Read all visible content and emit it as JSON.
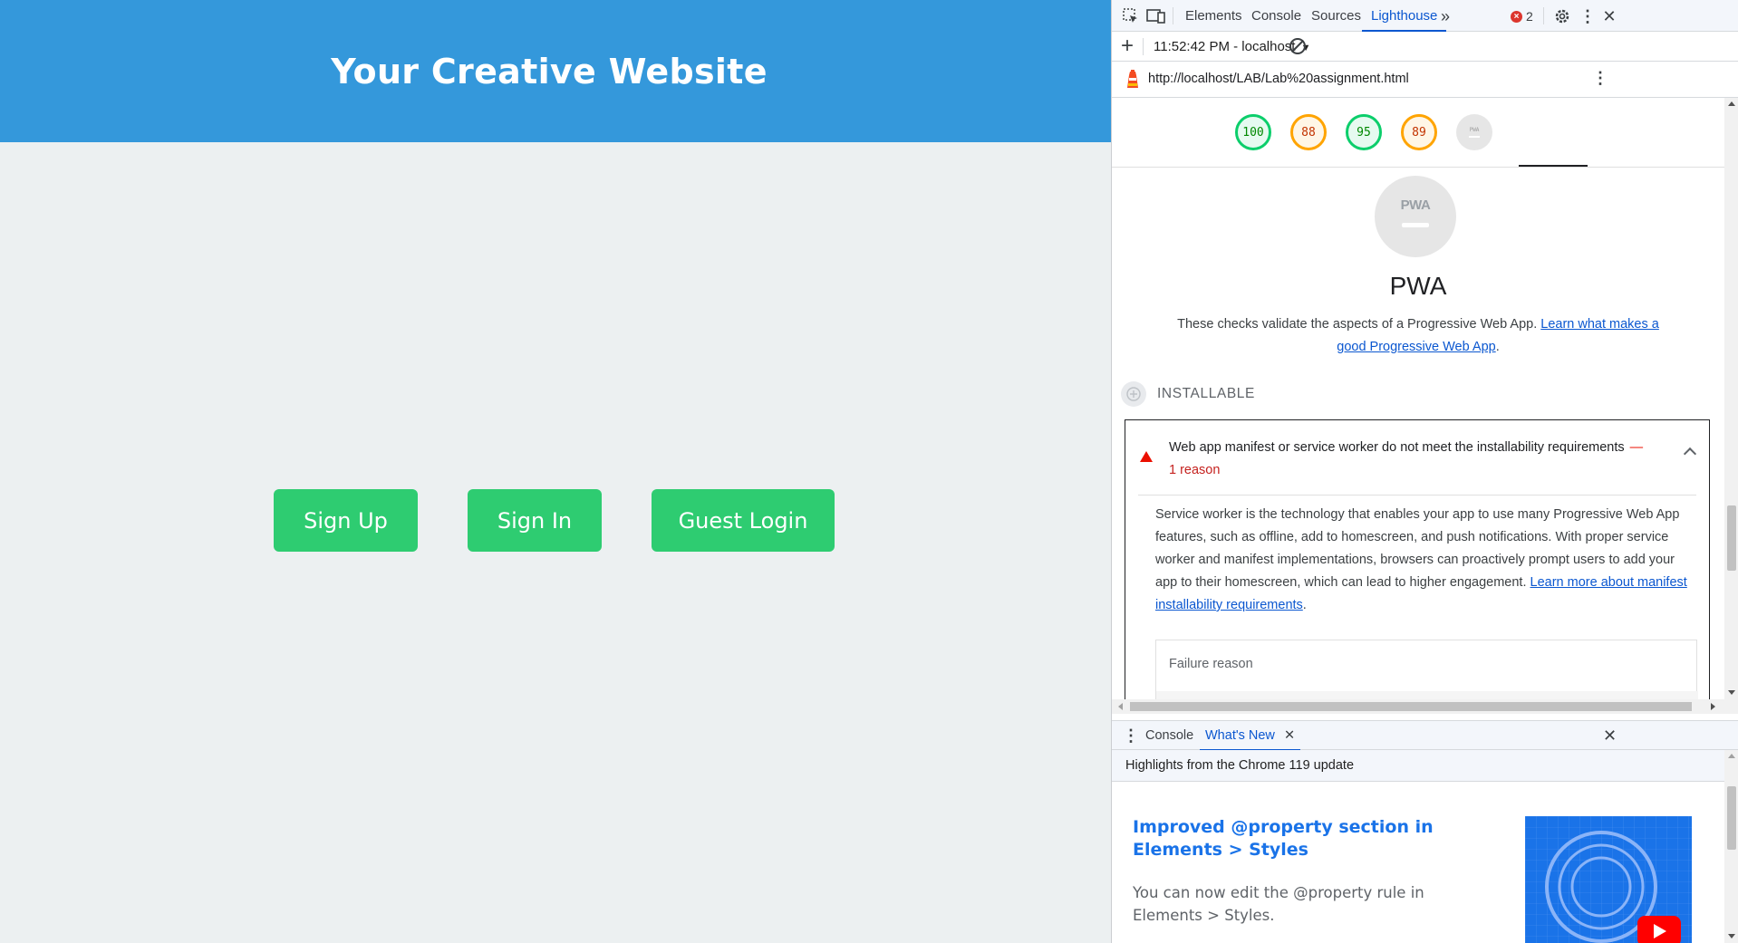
{
  "site": {
    "title": "Your Creative Website",
    "buttons": {
      "sign_up": "Sign Up",
      "sign_in": "Sign In",
      "guest_login": "Guest Login"
    },
    "colors": {
      "header": "#3498db",
      "button": "#2ecc71",
      "background": "#ecf0f1"
    }
  },
  "devtools": {
    "tabs": [
      "Elements",
      "Console",
      "Sources",
      "Lighthouse"
    ],
    "active_tab": "Lighthouse",
    "error_count": "2",
    "toolbar": {
      "session": "11:52:42 PM - localhost"
    },
    "url": "http://localhost/LAB/Lab%20assignment.html",
    "scores": [
      {
        "value": "100",
        "status": "pass"
      },
      {
        "value": "88",
        "status": "average"
      },
      {
        "value": "95",
        "status": "pass"
      },
      {
        "value": "89",
        "status": "average"
      }
    ],
    "pwa_gauge_logo": "PWA",
    "report": {
      "category_title": "PWA",
      "description": "These checks validate the aspects of a Progressive Web App. ",
      "description_link": "Learn what makes a good Progressive Web App",
      "description_end": ".",
      "group_label": "INSTALLABLE",
      "audit": {
        "title": "Web app manifest or service worker do not meet the installability requirements",
        "dash": "—",
        "reason_count": "1 reason",
        "body": "Service worker is the technology that enables your app to use many Progressive Web App features, such as offline, add to homescreen, and push notifications. With proper service worker and manifest implementations, browsers can proactively prompt users to add your app to their homescreen, which can lead to higher engagement. ",
        "body_link": "Learn more about manifest installability requirements",
        "body_end": ".",
        "table_header": "Failure reason"
      }
    },
    "drawer": {
      "tabs": [
        "Console",
        "What's New"
      ],
      "active_tab": "What's New",
      "highlight": "Highlights from the Chrome 119 update",
      "feature_title": "Improved @property section in Elements > Styles",
      "feature_text": "You can now edit the @property rule in Elements > Styles."
    }
  }
}
